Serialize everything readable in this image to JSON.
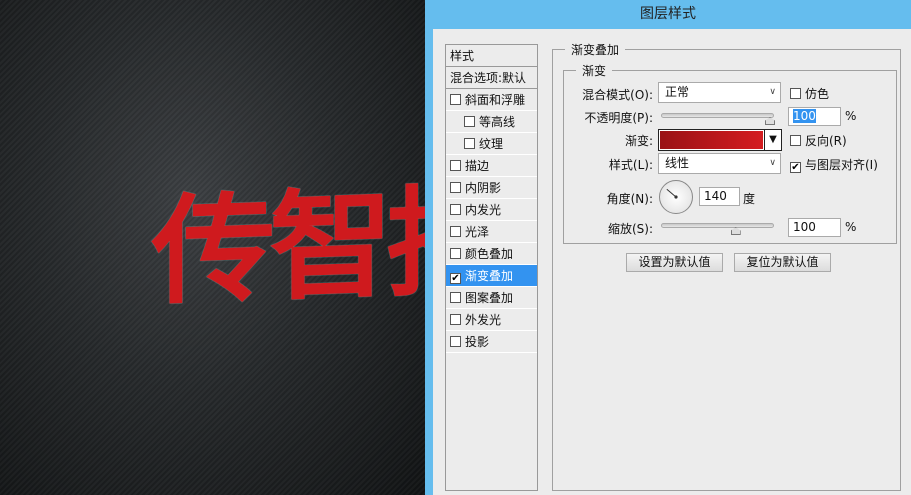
{
  "canvas": {
    "art_text": "传智播"
  },
  "dialog": {
    "title": "图层样式",
    "styles_list": [
      {
        "label": "样式",
        "type": "header"
      },
      {
        "label": "混合选项:默认",
        "type": "header"
      },
      {
        "label": "斜面和浮雕",
        "checked": false
      },
      {
        "label": "等高线",
        "checked": false,
        "sub": true
      },
      {
        "label": "纹理",
        "checked": false,
        "sub": true
      },
      {
        "label": "描边",
        "checked": false
      },
      {
        "label": "内阴影",
        "checked": false
      },
      {
        "label": "内发光",
        "checked": false
      },
      {
        "label": "光泽",
        "checked": false
      },
      {
        "label": "颜色叠加",
        "checked": false
      },
      {
        "label": "渐变叠加",
        "checked": true,
        "selected": true
      },
      {
        "label": "图案叠加",
        "checked": false
      },
      {
        "label": "外发光",
        "checked": false
      },
      {
        "label": "投影",
        "checked": false
      }
    ],
    "panel": {
      "group_title": "渐变叠加",
      "sub_title": "渐变",
      "blend_mode_label": "混合模式(O):",
      "blend_mode_value": "正常",
      "dither_label": "仿色",
      "dither_checked": false,
      "opacity_label": "不透明度(P):",
      "opacity_value": "100",
      "opacity_unit": "%",
      "opacity_percent": 100,
      "gradient_label": "渐变:",
      "gradient_colors": [
        "#9a1216",
        "#d41c20"
      ],
      "reverse_label": "反向(R)",
      "reverse_checked": false,
      "style_label": "样式(L):",
      "style_value": "线性",
      "align_label": "与图层对齐(I)",
      "align_checked": true,
      "angle_label": "角度(N):",
      "angle_value": "140",
      "angle_unit": "度",
      "scale_label": "缩放(S):",
      "scale_value": "100",
      "scale_unit": "%",
      "scale_percent": 100,
      "make_default_label": "设置为默认值",
      "reset_default_label": "复位为默认值"
    }
  }
}
